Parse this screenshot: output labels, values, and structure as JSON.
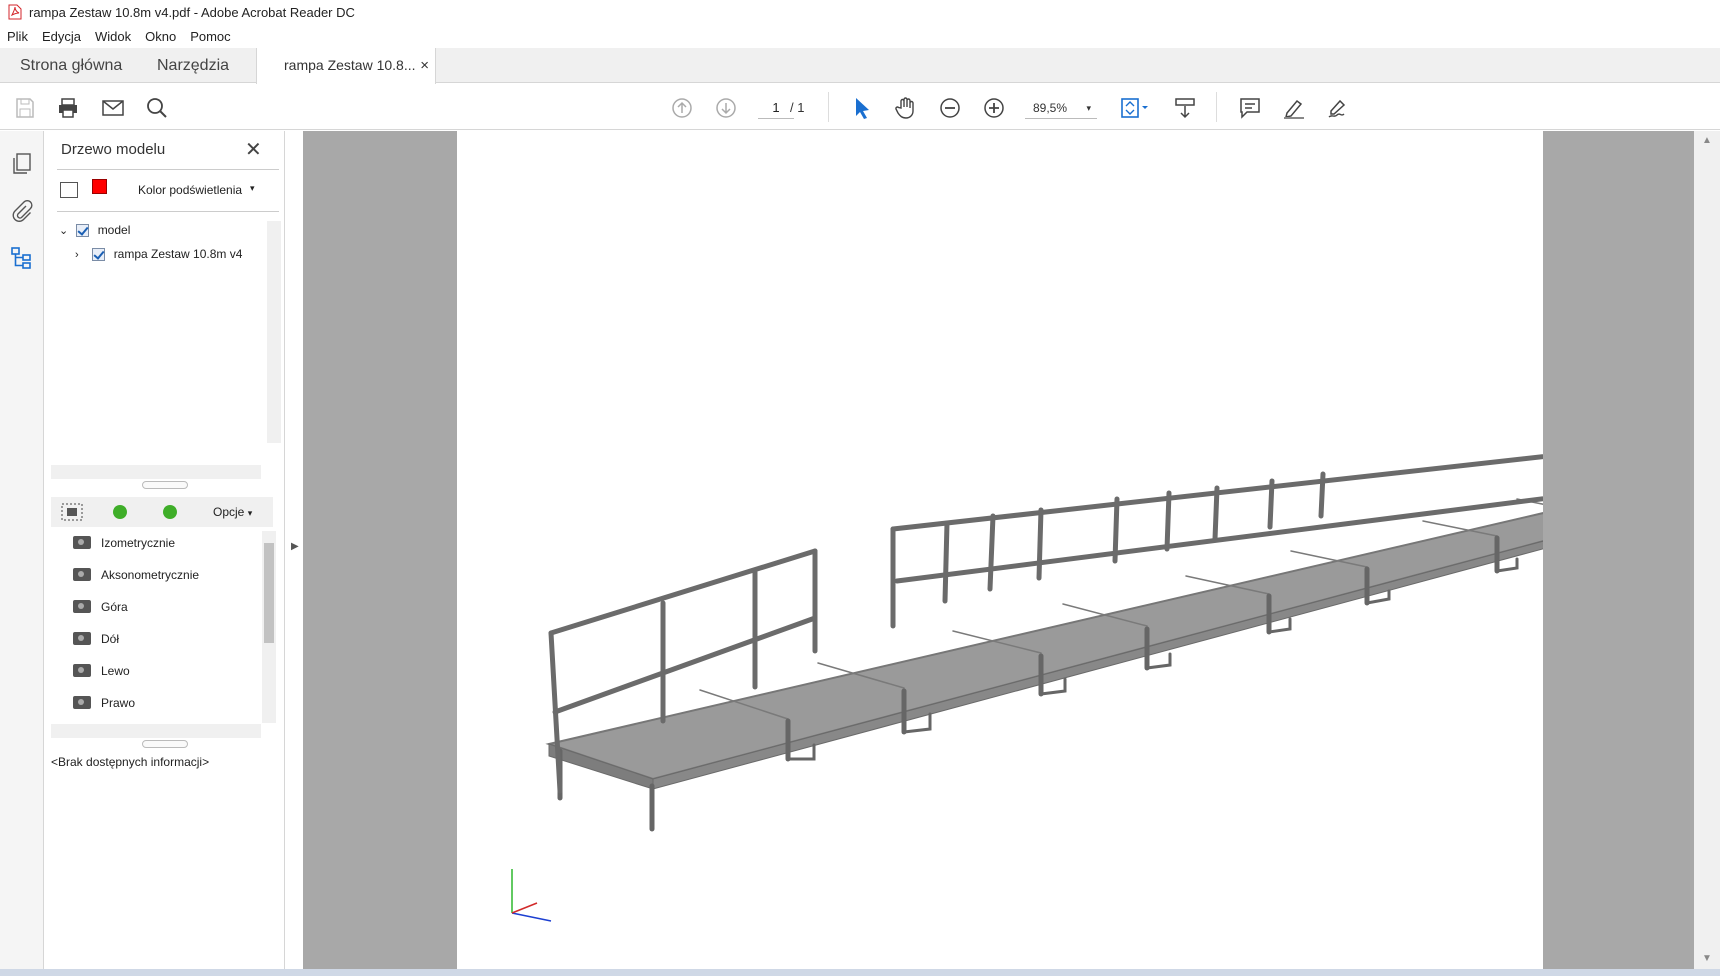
{
  "window": {
    "title": "rampa Zestaw 10.8m v4.pdf - Adobe Acrobat Reader DC"
  },
  "menu": [
    "Plik",
    "Edycja",
    "Widok",
    "Okno",
    "Pomoc"
  ],
  "tabs": {
    "home": "Strona główna",
    "tools": "Narzędzia",
    "document": "rampa Zestaw 10.8...",
    "close": "×"
  },
  "toolbar": {
    "page_current": "1",
    "page_total": "/ 1",
    "zoom": "89,5%",
    "zoom_arrow": "▾"
  },
  "panel": {
    "title": "Drzewo modelu",
    "close": "✕",
    "highlight_label": "Kolor podświetlenia",
    "highlight_color": "#ff0000",
    "tree": [
      {
        "label": "model",
        "expanded": true,
        "checked": true
      },
      {
        "label": "rampa Zestaw 10.8m v4",
        "expanded": false,
        "checked": true
      }
    ],
    "views_options": "Opcje",
    "views": [
      "Izometrycznie",
      "Aksonometrycznie",
      "Góra",
      "Dół",
      "Lewo",
      "Prawo"
    ],
    "info": "<Brak dostępnych informacji>"
  },
  "icons": {
    "save": "save-icon",
    "print": "print-icon",
    "email": "email-icon",
    "search": "search-icon",
    "prev_page": "arrow-up-icon",
    "next_page": "arrow-down-icon",
    "select": "cursor-icon",
    "hand": "hand-icon",
    "zoom_out": "zoom-out-icon",
    "zoom_in": "zoom-in-icon",
    "fit": "fit-page-icon",
    "scroll": "scroll-mode-icon",
    "comment": "comment-icon",
    "highlight": "highlight-pen-icon",
    "sign": "sign-icon"
  }
}
